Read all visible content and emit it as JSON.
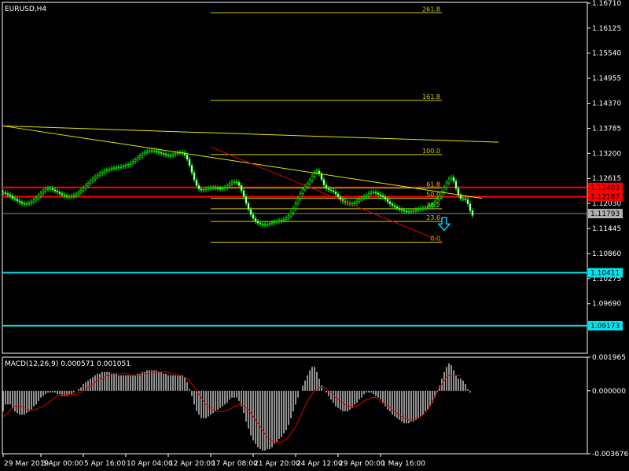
{
  "window": {
    "title": "EURUSD,H4"
  },
  "chart_data": [
    {
      "type": "candlestick",
      "title": "EURUSD,H4",
      "ylim": [
        1.0853,
        1.16727
      ],
      "y_ticks": [
        "1.16710",
        "1.16125",
        "1.15540",
        "1.14955",
        "1.14370",
        "1.13785",
        "1.13200",
        "1.12615",
        "1.12030",
        "1.11445",
        "1.10860",
        "1.10275",
        "1.09690"
      ],
      "y_tick_values": [
        1.1671,
        1.16125,
        1.1554,
        1.14955,
        1.1437,
        1.13785,
        1.132,
        1.12615,
        1.1203,
        1.11445,
        1.1086,
        1.10275,
        1.0969
      ],
      "x_tick_labels": [
        "29 Mar 2019",
        "3 Apr 00:00",
        "5 Apr 16:00",
        "10 Apr 04:00",
        "12 Apr 20:00",
        "17 Apr 08:00",
        "21 Apr 20:00",
        "24 Apr 12:00",
        "29 Apr 00:00",
        "1 May 16:00"
      ],
      "x_tick_bar_index": [
        0,
        16,
        34,
        52,
        70,
        88,
        106,
        124,
        142,
        160
      ],
      "price_close_series": [
        1.1228,
        1.1226,
        1.1223,
        1.122,
        1.1215,
        1.1213,
        1.1209,
        1.1206,
        1.1203,
        1.1202,
        1.1202,
        1.1204,
        1.1207,
        1.1211,
        1.1216,
        1.1221,
        1.1227,
        1.1232,
        1.1236,
        1.1238,
        1.1238,
        1.1235,
        1.1232,
        1.1229,
        1.1226,
        1.1223,
        1.1221,
        1.1219,
        1.1219,
        1.122,
        1.1222,
        1.1225,
        1.1229,
        1.1234,
        1.1239,
        1.1245,
        1.125,
        1.1255,
        1.126,
        1.1265,
        1.1269,
        1.1273,
        1.1276,
        1.1279,
        1.1281,
        1.1283,
        1.1285,
        1.1286,
        1.1287,
        1.1288,
        1.1289,
        1.129,
        1.1292,
        1.1294,
        1.1297,
        1.1301,
        1.1305,
        1.131,
        1.1314,
        1.1319,
        1.1322,
        1.1325,
        1.1326,
        1.1326,
        1.1326,
        1.1324,
        1.1322,
        1.132,
        1.1318,
        1.1316,
        1.1315,
        1.1315,
        1.1317,
        1.1319,
        1.1321,
        1.1322,
        1.1321,
        1.1316,
        1.1306,
        1.1292,
        1.1275,
        1.1258,
        1.1245,
        1.1237,
        1.1234,
        1.1235,
        1.1237,
        1.1239,
        1.124,
        1.124,
        1.1239,
        1.1238,
        1.1237,
        1.1238,
        1.124,
        1.1244,
        1.1249,
        1.1253,
        1.1254,
        1.1252,
        1.1245,
        1.1233,
        1.1219,
        1.1203,
        1.1189,
        1.1177,
        1.1168,
        1.1161,
        1.1157,
        1.1155,
        1.1154,
        1.1154,
        1.1154,
        1.1156,
        1.1158,
        1.116,
        1.1161,
        1.1163,
        1.1164,
        1.1166,
        1.1169,
        1.1174,
        1.1181,
        1.1191,
        1.1203,
        1.1215,
        1.1226,
        1.1236,
        1.1243,
        1.1249,
        1.1257,
        1.1267,
        1.1276,
        1.1279,
        1.1272,
        1.1259,
        1.1246,
        1.1238,
        1.1235,
        1.1233,
        1.123,
        1.1225,
        1.1218,
        1.1212,
        1.1208,
        1.1205,
        1.1203,
        1.1202,
        1.1202,
        1.1204,
        1.1208,
        1.1212,
        1.1216,
        1.1219,
        1.1222,
        1.1226,
        1.1229,
        1.1229,
        1.1227,
        1.1224,
        1.1221,
        1.1218,
        1.1213,
        1.1207,
        1.1202,
        1.1198,
        1.1195,
        1.1192,
        1.1189,
        1.1187,
        1.1185,
        1.1184,
        1.1184,
        1.1185,
        1.1186,
        1.1188,
        1.119,
        1.1191,
        1.1192,
        1.1193,
        1.1195,
        1.1197,
        1.12,
        1.1206,
        1.1213,
        1.122,
        1.1229,
        1.124,
        1.1251,
        1.126,
        1.1264,
        1.1255,
        1.1238,
        1.1222,
        1.1214,
        1.1214,
        1.1212,
        1.1202,
        1.1186,
        1.1175
      ],
      "price_labels": [
        {
          "value": 1.12403,
          "label": "1.12403",
          "color": "#ff0000"
        },
        {
          "value": 1.12187,
          "label": "1.12187",
          "color": "#ff0000"
        },
        {
          "value": 1.11793,
          "label": "1.11793",
          "color": "#b0b0b0"
        },
        {
          "value": 1.10411,
          "label": "1.10411",
          "color": "#00e5ee"
        },
        {
          "value": 1.09173,
          "label": "1.09173",
          "color": "#00e5ee"
        }
      ],
      "horizontal_lines": [
        {
          "value": 1.12403,
          "color": "#ff0000"
        },
        {
          "value": 1.12187,
          "color": "#ff0000"
        },
        {
          "value": 1.11793,
          "color": "#8c8c8c"
        },
        {
          "value": 1.10411,
          "color": "#00e5ee"
        },
        {
          "value": 1.09173,
          "color": "#00e5ee"
        }
      ],
      "fibonacci": {
        "color": "#cfcf00",
        "levels": [
          {
            "label": "261.8",
            "value": 1.16483
          },
          {
            "label": "161.8",
            "value": 1.14437
          },
          {
            "label": "100.0",
            "value": 1.13172
          },
          {
            "label": "61.8",
            "value": 1.1239
          },
          {
            "label": "50.0",
            "value": 1.12149
          },
          {
            "label": "38.2",
            "value": 1.11907
          },
          {
            "label": "23.6",
            "value": 1.11608
          },
          {
            "label": "0.0",
            "value": 1.11125
          }
        ],
        "bar_start": 88,
        "bar_end": 186
      },
      "trendlines": [
        {
          "color": "#e6e600",
          "from": {
            "bar": 0,
            "value": 1.1384
          },
          "to": {
            "bar": 210,
            "value": 1.1346
          }
        },
        {
          "color": "#e6e600",
          "from": {
            "bar": 0,
            "value": 1.1384
          },
          "to": {
            "bar": 203,
            "value": 1.1215
          }
        },
        {
          "color": "#e60000",
          "from": {
            "bar": 88,
            "value": 1.1335
          },
          "to": {
            "bar": 186,
            "value": 1.1114
          }
        }
      ],
      "signal_arrow": {
        "direction": "down",
        "color": "#00d0ff",
        "bar": 187,
        "value": 1.1155
      }
    },
    {
      "type": "histogram",
      "title": "MACD(12,26,9) 0.000571 0.001051",
      "ylim": [
        -0.003676,
        0.001965
      ],
      "y_ticks": [
        "0.001965",
        "0.000000",
        "-0.003676"
      ],
      "y_tick_values": [
        0.001965,
        0.0,
        -0.003676
      ],
      "histogram_values": [
        -0.0012,
        -0.0008,
        -0.0008,
        -0.0008,
        -0.001,
        -0.0012,
        -0.0013,
        -0.0014,
        -0.0014,
        -0.0014,
        -0.0013,
        -0.0012,
        -0.0011,
        -0.0009,
        -0.0008,
        -0.0006,
        -0.0004,
        -0.0003,
        -0.0002,
        -0.0001,
        -0.0001,
        -0.0001,
        -0.0001,
        -0.0002,
        -0.0002,
        -0.0003,
        -0.0003,
        -0.0003,
        -0.0002,
        -0.0002,
        -0.0001,
        -0.0,
        0.0001,
        0.0002,
        0.0004,
        0.0005,
        0.0006,
        0.0007,
        0.0008,
        0.0009,
        0.001,
        0.001,
        0.0011,
        0.0011,
        0.0011,
        0.0011,
        0.001,
        0.001,
        0.001,
        0.0009,
        0.0009,
        0.0009,
        0.0009,
        0.0009,
        0.0009,
        0.0009,
        0.0009,
        0.001,
        0.001,
        0.0011,
        0.0011,
        0.0012,
        0.0012,
        0.0012,
        0.0012,
        0.0012,
        0.0011,
        0.0011,
        0.001,
        0.001,
        0.0009,
        0.0009,
        0.0009,
        0.0009,
        0.0009,
        0.0009,
        0.0009,
        0.0008,
        0.0005,
        0.0001,
        -0.0003,
        -0.0008,
        -0.0012,
        -0.0014,
        -0.0016,
        -0.0016,
        -0.0016,
        -0.0015,
        -0.0014,
        -0.0013,
        -0.0012,
        -0.0011,
        -0.001,
        -0.0009,
        -0.0008,
        -0.0007,
        -0.0005,
        -0.0004,
        -0.0004,
        -0.0004,
        -0.0006,
        -0.0009,
        -0.0013,
        -0.0018,
        -0.0022,
        -0.0026,
        -0.0029,
        -0.0031,
        -0.0033,
        -0.0034,
        -0.0035,
        -0.0035,
        -0.0034,
        -0.0034,
        -0.0033,
        -0.0031,
        -0.003,
        -0.0028,
        -0.0027,
        -0.0025,
        -0.0023,
        -0.002,
        -0.0016,
        -0.0012,
        -0.0008,
        -0.0004,
        0.0,
        0.0003,
        0.0006,
        0.0009,
        0.0012,
        0.0014,
        0.0014,
        0.0011,
        0.0007,
        0.0003,
        0.0,
        -0.0001,
        -0.0003,
        -0.0005,
        -0.0007,
        -0.0009,
        -0.001,
        -0.0011,
        -0.0012,
        -0.0012,
        -0.0012,
        -0.0011,
        -0.001,
        -0.0008,
        -0.0007,
        -0.0005,
        -0.0004,
        -0.0002,
        -0.0001,
        -0.0001,
        -0.0001,
        -0.0002,
        -0.0003,
        -0.0004,
        -0.0005,
        -0.0007,
        -0.0009,
        -0.0011,
        -0.0012,
        -0.0014,
        -0.0015,
        -0.0016,
        -0.0017,
        -0.0018,
        -0.0019,
        -0.0019,
        -0.0019,
        -0.0018,
        -0.0018,
        -0.0017,
        -0.0016,
        -0.0015,
        -0.0014,
        -0.0012,
        -0.0011,
        -0.0009,
        -0.0007,
        -0.0004,
        -0.0001,
        0.0003,
        0.0007,
        0.0011,
        0.0014,
        0.0016,
        0.0015,
        0.0012,
        0.0009,
        0.0007,
        0.0007,
        0.0006,
        0.0004,
        0.0001,
        -0.0001
      ],
      "signal_values": [
        -0.0015,
        -0.0014,
        -0.0013,
        -0.0011,
        -0.001,
        -0.0009,
        -0.0009,
        -0.0009,
        -0.0009,
        -0.001,
        -0.0011,
        -0.0011,
        -0.0011,
        -0.0011,
        -0.0011,
        -0.001,
        -0.001,
        -0.0009,
        -0.0008,
        -0.0007,
        -0.0006,
        -0.0005,
        -0.0004,
        -0.0003,
        -0.0003,
        -0.0002,
        -0.0002,
        -0.0002,
        -0.0002,
        -0.0002,
        -0.0002,
        -0.0002,
        -0.0001,
        -0.0001,
        -0.0,
        0.0001,
        0.0002,
        0.0003,
        0.0004,
        0.0005,
        0.0006,
        0.0007,
        0.0007,
        0.0008,
        0.0009,
        0.0009,
        0.001,
        0.001,
        0.001,
        0.001,
        0.001,
        0.001,
        0.001,
        0.001,
        0.0009,
        0.0009,
        0.0009,
        0.0009,
        0.0009,
        0.001,
        0.001,
        0.001,
        0.001,
        0.0011,
        0.0011,
        0.0011,
        0.0011,
        0.0011,
        0.0011,
        0.0011,
        0.0011,
        0.001,
        0.001,
        0.001,
        0.0009,
        0.0009,
        0.0008,
        0.0008,
        0.0007,
        0.0006,
        0.0004,
        0.0002,
        -0.0,
        -0.0002,
        -0.0004,
        -0.0006,
        -0.0008,
        -0.0009,
        -0.001,
        -0.0011,
        -0.0012,
        -0.0012,
        -0.0012,
        -0.0012,
        -0.0012,
        -0.0011,
        -0.0011,
        -0.001,
        -0.0009,
        -0.0009,
        -0.0008,
        -0.0008,
        -0.0009,
        -0.001,
        -0.0011,
        -0.0013,
        -0.0015,
        -0.0017,
        -0.0019,
        -0.0021,
        -0.0023,
        -0.0025,
        -0.0027,
        -0.0028,
        -0.0029,
        -0.003,
        -0.003,
        -0.003,
        -0.003,
        -0.0029,
        -0.0028,
        -0.0027,
        -0.0025,
        -0.0023,
        -0.0021,
        -0.0018,
        -0.0015,
        -0.0012,
        -0.0009,
        -0.0006,
        -0.0004,
        -0.0002,
        0.0,
        0.0001,
        0.0002,
        0.0002,
        0.0002,
        0.0001,
        0.0,
        -0.0001,
        -0.0002,
        -0.0004,
        -0.0005,
        -0.0006,
        -0.0007,
        -0.0008,
        -0.0009,
        -0.0009,
        -0.0009,
        -0.0009,
        -0.0009,
        -0.0008,
        -0.0007,
        -0.0006,
        -0.0005,
        -0.0005,
        -0.0004,
        -0.0004,
        -0.0004,
        -0.0005,
        -0.0006,
        -0.0007,
        -0.0008,
        -0.0009,
        -0.001,
        -0.0011,
        -0.0012,
        -0.0013,
        -0.0014,
        -0.0015,
        -0.0016,
        -0.0016,
        -0.0017,
        -0.0017,
        -0.0017,
        -0.0016,
        -0.0016,
        -0.0015,
        -0.0014,
        -0.0013,
        -0.0011,
        -0.0009,
        -0.0006,
        -0.0003,
        -0.0001,
        0.0002,
        0.0004,
        0.0006,
        0.0008,
        0.0009,
        0.0009,
        0.0009,
        0.0009,
        0.0009,
        0.0009
      ]
    }
  ]
}
